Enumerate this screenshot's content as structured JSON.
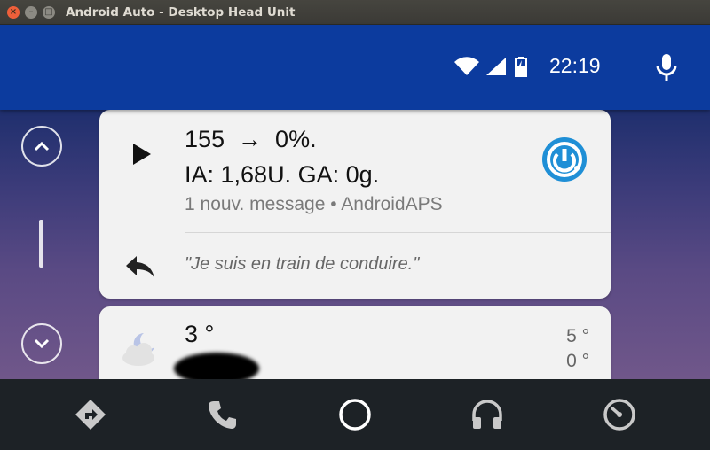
{
  "window": {
    "title": "Android Auto - Desktop Head Unit",
    "buttons": [
      "×",
      "–",
      "□"
    ]
  },
  "status": {
    "time": "22:19",
    "icons": [
      "wifi-icon",
      "signal-icon",
      "battery-charging-icon"
    ],
    "mic_icon": "mic-icon"
  },
  "notification": {
    "line1": "155  →  0%.",
    "line2": "IA: 1,68U. GA: 0g.",
    "subtitle": "1 nouv. message • AndroidAPS",
    "reply_text": "\"Je suis en train de conduire.\"",
    "app_icon": "androidaps-icon"
  },
  "weather": {
    "temperature": "3 °",
    "high": "5 °",
    "low": "0 °",
    "icon": "night-cloudy-icon"
  },
  "nav": {
    "items": [
      "navigation-icon",
      "phone-icon",
      "home-icon",
      "headphones-icon",
      "dashboard-icon"
    ]
  },
  "colors": {
    "header": "#0c3b9e",
    "nav_bar": "#1d2226",
    "card": "#f2f2f2",
    "app_icon_blue": "#1f8fd6"
  }
}
